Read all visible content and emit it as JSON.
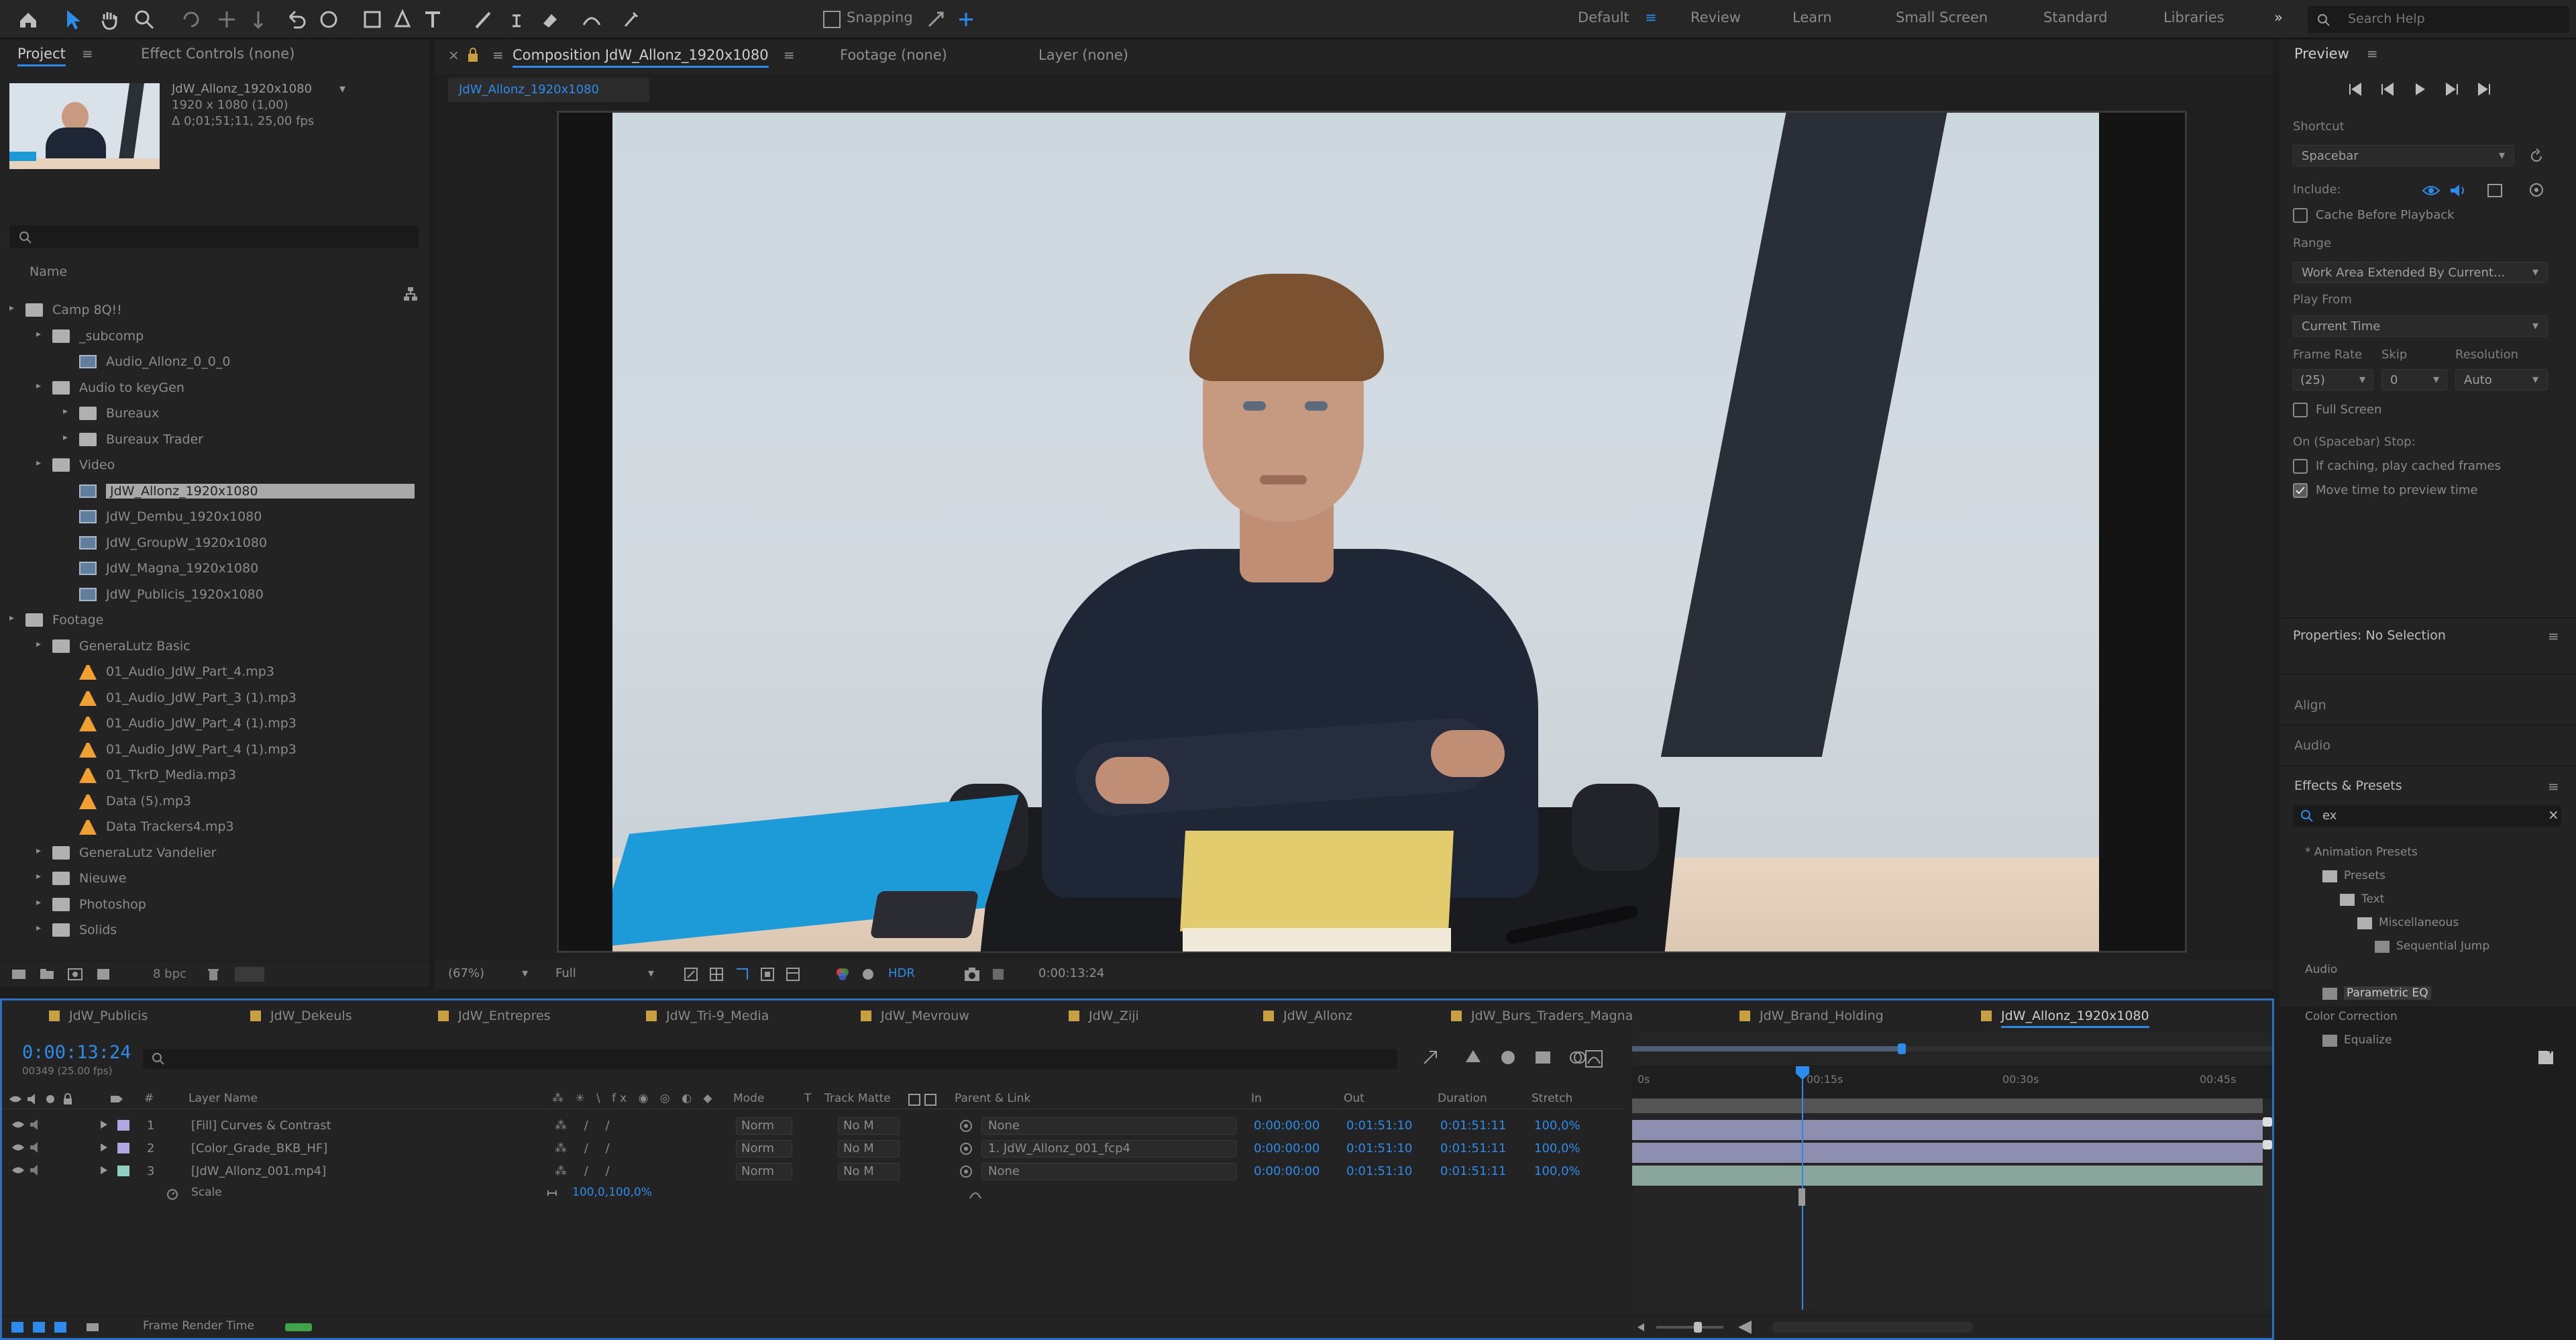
{
  "toolbar": {
    "snapping_label": "Snapping",
    "workspaces": [
      "Default",
      "Review",
      "Learn",
      "Small Screen",
      "Standard",
      "Libraries"
    ],
    "search_placeholder": "Search Help"
  },
  "project": {
    "tabs": [
      "Project",
      "Effect Controls (none)"
    ],
    "thumb_info": {
      "name": "JdW_Allonz_1920x1080",
      "size": "1920 x 1080 (1,00)",
      "duration": "Δ 0;01;51;11, 25,00 fps"
    },
    "column_header": "Name",
    "tree": [
      {
        "label": "Camp 8Q!!",
        "kind": "folder",
        "indent": 0
      },
      {
        "label": "_subcomp",
        "kind": "folder",
        "indent": 1
      },
      {
        "label": "Audio_Allonz_0_0_0",
        "kind": "video",
        "indent": 2
      },
      {
        "label": "Audio to keyGen",
        "kind": "folder",
        "indent": 1
      },
      {
        "label": "Bureaux",
        "kind": "folder",
        "indent": 2
      },
      {
        "label": "Bureaux Trader",
        "kind": "folder",
        "indent": 2
      },
      {
        "label": "Video",
        "kind": "folder",
        "indent": 1
      },
      {
        "label": "JdW_Allonz_1920x1080",
        "kind": "video",
        "indent": 2,
        "selected": true
      },
      {
        "label": "JdW_Dembu_1920x1080",
        "kind": "video",
        "indent": 2
      },
      {
        "label": "JdW_GroupW_1920x1080",
        "kind": "video",
        "indent": 2
      },
      {
        "label": "JdW_Magna_1920x1080",
        "kind": "video",
        "indent": 2
      },
      {
        "label": "JdW_Publicis_1920x1080",
        "kind": "video",
        "indent": 2
      },
      {
        "label": "Footage",
        "kind": "folder",
        "indent": 0
      },
      {
        "label": "GeneraLutz Basic",
        "kind": "folder",
        "indent": 1
      },
      {
        "label": "01_Audio_JdW_Part_4.mp3",
        "kind": "audio",
        "indent": 2
      },
      {
        "label": "01_Audio_JdW_Part_3 (1).mp3",
        "kind": "audio",
        "indent": 2
      },
      {
        "label": "01_Audio_JdW_Part_4 (1).mp3",
        "kind": "audio",
        "indent": 2
      },
      {
        "label": "01_Audio_JdW_Part_4 (1).mp3",
        "kind": "audio",
        "indent": 2
      },
      {
        "label": "01_TkrD_Media.mp3",
        "kind": "audio",
        "indent": 2
      },
      {
        "label": "Data (5).mp3",
        "kind": "audio",
        "indent": 2
      },
      {
        "label": "Data Trackers4.mp3",
        "kind": "audio",
        "indent": 2
      },
      {
        "label": "GeneraLutz Vandelier",
        "kind": "folder",
        "indent": 1
      },
      {
        "label": "Nieuwe",
        "kind": "folder",
        "indent": 1
      },
      {
        "label": "Photoshop",
        "kind": "folder",
        "indent": 1
      },
      {
        "label": "Solids",
        "kind": "folder",
        "indent": 1
      }
    ],
    "bpc": "8 bpc"
  },
  "comp": {
    "tabs": [
      "Composition JdW_Allonz_1920x1080",
      "Footage (none)",
      "Layer (none)"
    ],
    "subtab": "JdW_Allonz_1920x1080",
    "zoom": "(67%)",
    "resolution": "Full",
    "timecode": "0:00:13:24"
  },
  "preview": {
    "title": "Preview",
    "shortcut_label": "Shortcut",
    "shortcut_value": "Spacebar",
    "include_label": "Include:",
    "cache_label": "Cache Before Playback",
    "range_label": "Range",
    "range_value": "Work Area Extended By Current...",
    "play_from_label": "Play From",
    "play_from_value": "Current Time",
    "frame_rate_label": "Frame Rate",
    "skip_label": "Skip",
    "resolution_label": "Resolution",
    "frame_rate_value": "(25)",
    "skip_value": "0",
    "resolution_value": "Auto",
    "full_screen_label": "Full Screen",
    "on_stop_label": "On (Spacebar) Stop:",
    "if_caching_label": "If caching, play cached frames",
    "move_time_label": "Move time to preview time"
  },
  "properties": {
    "title": "Properties: No Selection",
    "align": "Align",
    "audio": "Audio",
    "effects_title": "Effects & Presets",
    "search_value": "ex",
    "tree": [
      "* Animation Presets",
      "Presets",
      "Text",
      "Miscellaneous",
      "Sequential Jump",
      "Audio",
      "Parametric EQ",
      "Color Correction",
      "Equalize"
    ]
  },
  "timeline": {
    "tabs": [
      "JdW_Publicis",
      "JdW_Dekeuls",
      "JdW_Entrepres",
      "JdW_Tri-9_Media",
      "JdW_Mevrouw",
      "JdW_Ziji",
      "JdW_Allonz",
      "JdW_Burs_Traders_Magna",
      "JdW_Brand_Holding",
      "JdW_Allonz_1920x1080"
    ],
    "current_time": "0:00:13:24",
    "frames_label": "00349 (25.00 fps)",
    "columns": {
      "layer_name": "Layer Name",
      "mode": "Mode",
      "track_matte": "Track Matte",
      "parent": "Parent & Link",
      "in": "In",
      "out": "Out",
      "duration": "Duration",
      "stretch": "Stretch"
    },
    "layers": [
      {
        "num": "1",
        "name": "[Fill] Curves & Contrast",
        "mode": "Norm",
        "matte": "No M",
        "parent": "None",
        "in": "0:00:00:00",
        "out": "0:01:51:10",
        "duration": "0:01:51:11",
        "stretch": "100,0%"
      },
      {
        "num": "2",
        "name": "[Color_Grade_BKB_HF]",
        "mode": "Norm",
        "matte": "No M",
        "parent": "1. JdW_Allonz_001_fcp4",
        "in": "0:00:00:00",
        "out": "0:01:51:10",
        "duration": "0:01:51:11",
        "stretch": "100,0%"
      },
      {
        "num": "3",
        "name": "[JdW_Allonz_001.mp4]",
        "mode": "Norm",
        "matte": "No M",
        "parent": "None",
        "in": "0:00:00:00",
        "out": "0:01:51:10",
        "duration": "0:01:51:11",
        "stretch": "100,0%"
      }
    ],
    "scale_label": "Scale",
    "scale_value": "100,0,100,0%",
    "ruler_ticks": [
      "0s",
      "00:15s",
      "00:30s",
      "00:45s"
    ],
    "frame_render_label": "Frame Render Time"
  }
}
